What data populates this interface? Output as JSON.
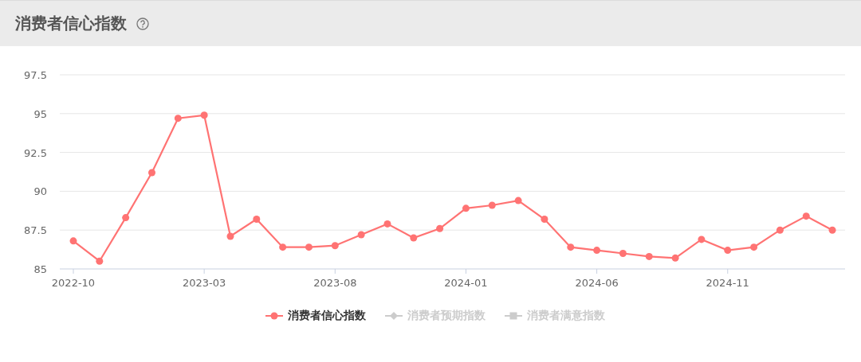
{
  "header": {
    "title": "消费者信心指数"
  },
  "chart": {
    "chart_data": {
      "type": "line",
      "categories": [
        "2022-10",
        null,
        null,
        null,
        null,
        "2023-03",
        null,
        null,
        null,
        null,
        "2023-08",
        null,
        null,
        null,
        null,
        "2024-01",
        null,
        null,
        null,
        null,
        "2024-06",
        null,
        null,
        null,
        null,
        "2024-11",
        null,
        null,
        null,
        null
      ],
      "series": [
        {
          "name": "消费者信心指数",
          "color": "#ff7373",
          "marker": "circle",
          "values": [
            86.8,
            85.5,
            88.3,
            91.2,
            94.7,
            94.9,
            87.1,
            88.2,
            86.4,
            86.4,
            86.5,
            87.2,
            87.9,
            87.0,
            87.6,
            88.9,
            89.1,
            89.4,
            88.2,
            86.4,
            86.2,
            86.0,
            85.8,
            85.7,
            86.9,
            86.2,
            86.4,
            87.5,
            88.4,
            87.5
          ]
        }
      ],
      "ylim": [
        85,
        97.5
      ],
      "yticks": [
        85,
        87.5,
        90,
        92.5,
        95,
        97.5
      ],
      "grid": true
    }
  },
  "legend": [
    {
      "kind": "circle",
      "color": "#ff7373",
      "active": true
    },
    {
      "label": "消费者预期指数",
      "kind": "diamond",
      "color": "#cccccc",
      "active": false
    },
    {
      "label": "消费者满意指数",
      "kind": "square",
      "color": "#cccccc",
      "active": false
    }
  ]
}
